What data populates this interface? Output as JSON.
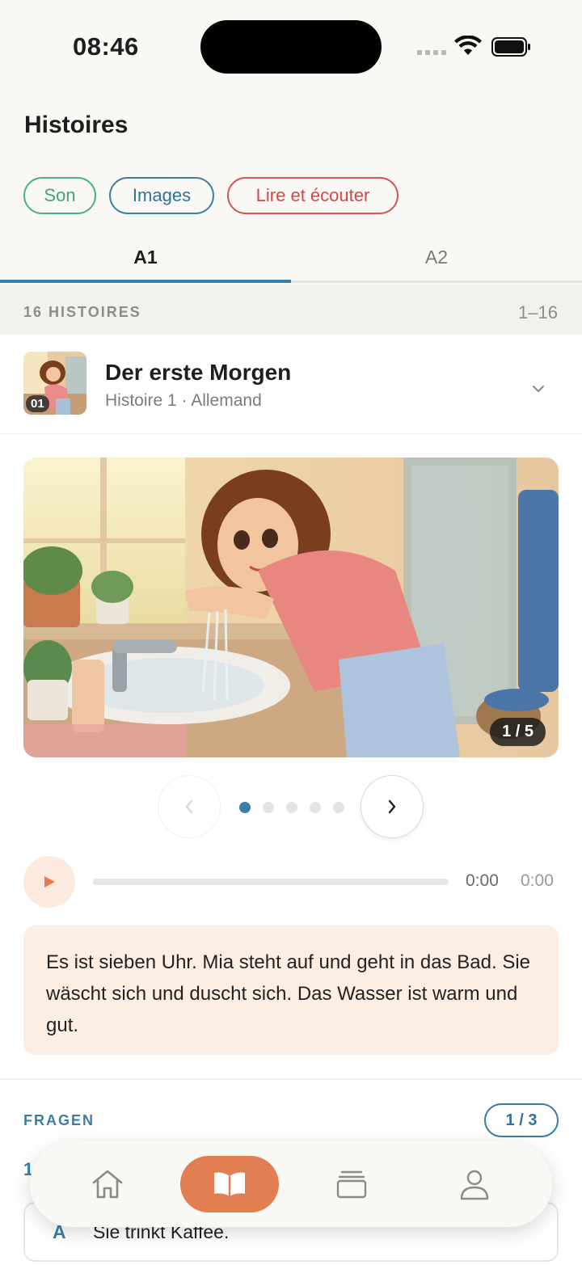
{
  "status": {
    "time": "08:46"
  },
  "page": {
    "title": "Histoires"
  },
  "filters": {
    "son": "Son",
    "images": "Images",
    "lire": "Lire et écouter"
  },
  "levels": [
    {
      "label": "A1",
      "active": true
    },
    {
      "label": "A2",
      "active": false
    }
  ],
  "list": {
    "count_label": "16 HISTOIRES",
    "range": "1–16"
  },
  "story": {
    "number": "01",
    "title": "Der erste Morgen",
    "subtitle": "Histoire 1 · Allemand",
    "slide_indicator": "1 / 5",
    "slide_count": 5,
    "current_slide": 1,
    "text": "Es ist sieben Uhr. Mia steht auf und geht in das Bad. Sie wäscht sich und duscht sich. Das Wasser ist warm und gut."
  },
  "player": {
    "current_time": "0:00",
    "total_time": "0:00",
    "progress": 0
  },
  "questions": {
    "label": "FRAGEN",
    "count": "1 / 3",
    "number": "1",
    "answer": {
      "letter": "A",
      "text": "Sie trinkt Kaffee."
    }
  },
  "colors": {
    "accent": "#3a7ea8",
    "orange": "#e27f52",
    "green": "#4bb08a",
    "red": "#d55454"
  },
  "icons": {
    "home": "home-icon",
    "read": "book-icon",
    "cards": "cards-icon",
    "profile": "profile-icon"
  }
}
